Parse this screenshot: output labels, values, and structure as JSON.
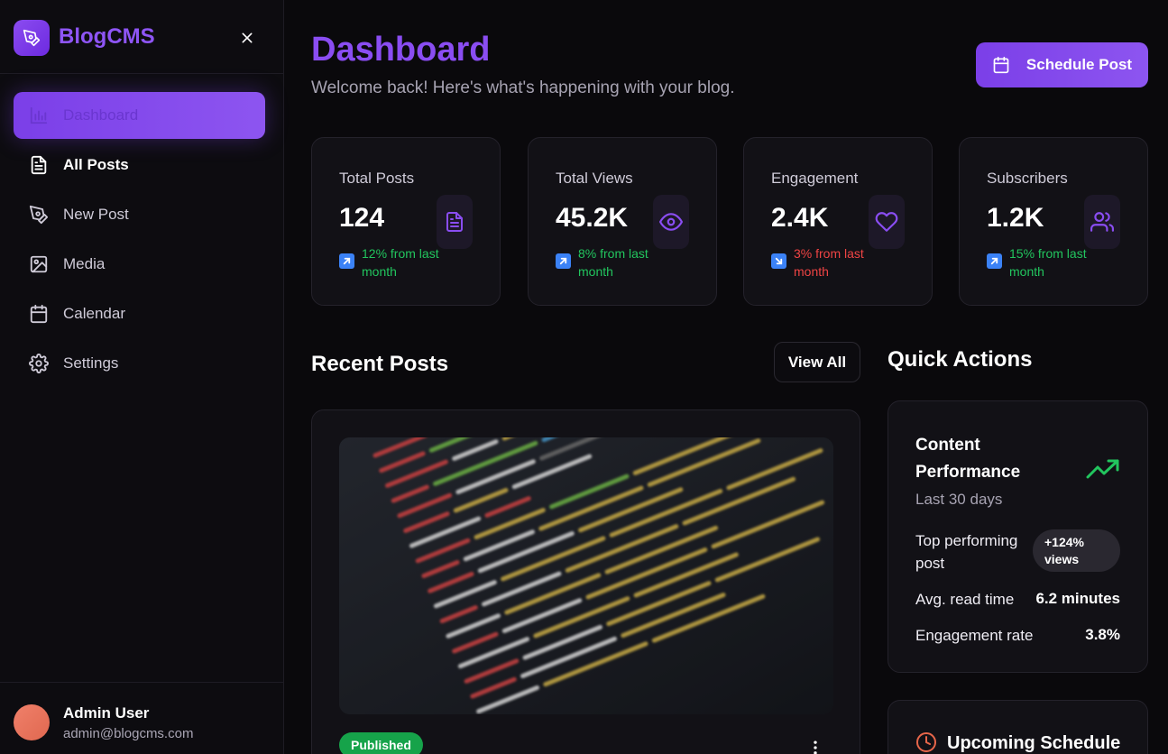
{
  "brand": {
    "name": "BlogCMS"
  },
  "sidebar": {
    "items": [
      {
        "label": "Dashboard",
        "icon": "bar-chart-icon"
      },
      {
        "label": "All Posts",
        "icon": "document-icon"
      },
      {
        "label": "New Post",
        "icon": "pen-icon"
      },
      {
        "label": "Media",
        "icon": "image-icon"
      },
      {
        "label": "Calendar",
        "icon": "calendar-icon"
      },
      {
        "label": "Settings",
        "icon": "gear-icon"
      }
    ]
  },
  "user": {
    "name": "Admin User",
    "email": "admin@blogcms.com"
  },
  "header": {
    "title": "Dashboard",
    "subtitle": "Welcome back! Here's what's happening with your blog.",
    "schedule_label": "Schedule Post"
  },
  "stats": [
    {
      "label": "Total Posts",
      "value": "124",
      "trend": "12% from last month",
      "direction": "up",
      "icon": "document-icon"
    },
    {
      "label": "Total Views",
      "value": "45.2K",
      "trend": "8% from last month",
      "direction": "up",
      "icon": "eye-icon"
    },
    {
      "label": "Engagement",
      "value": "2.4K",
      "trend": "3% from last month",
      "direction": "down",
      "icon": "heart-icon"
    },
    {
      "label": "Subscribers",
      "value": "1.2K",
      "trend": "15% from last month",
      "direction": "up",
      "icon": "users-icon"
    }
  ],
  "recent_posts": {
    "title": "Recent Posts",
    "view_all_label": "View All",
    "posts": [
      {
        "status": "Published"
      }
    ]
  },
  "quick_actions": {
    "title": "Quick Actions",
    "performance": {
      "title": "Content Performance",
      "subtitle": "Last 30 days",
      "rows": [
        {
          "label": "Top performing post",
          "value": "+124% views"
        },
        {
          "label": "Avg. read time",
          "value": "6.2 minutes"
        },
        {
          "label": "Engagement rate",
          "value": "3.8%"
        }
      ]
    },
    "schedule": {
      "title": "Upcoming Schedule"
    }
  },
  "colors": {
    "accent": "#8a4df2",
    "up": "#22c55e",
    "down": "#ef4444",
    "published": "#16a34a"
  }
}
